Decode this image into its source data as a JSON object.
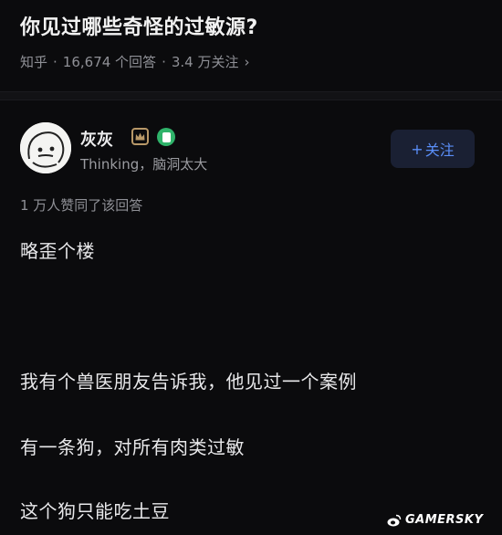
{
  "question": {
    "title": "你见过哪些奇怪的过敏源?",
    "source": "知乎",
    "sep1": "·",
    "answers": "16,674 个回答",
    "sep2": "·",
    "followers": "3.4 万关注",
    "chevron": "›"
  },
  "author": {
    "name": "灰灰",
    "bio": "Thinking，脑洞太大",
    "follow_label": "关注",
    "follow_plus": "+"
  },
  "answer": {
    "likes": "1 万人赞同了该回答",
    "paragraphs": [
      "略歪个楼",
      "我有个兽医朋友告诉我，他见过一个案例",
      "有一条狗，对所有肉类过敏",
      "这个狗只能吃土豆"
    ]
  },
  "watermark": {
    "text": "GAMERSKY",
    "icon": "weibo-icon"
  },
  "colors": {
    "background": "#0b0b0d",
    "accent": "#5a8ef7",
    "badge_gold": "#b89868",
    "badge_green": "#2fb36a"
  }
}
